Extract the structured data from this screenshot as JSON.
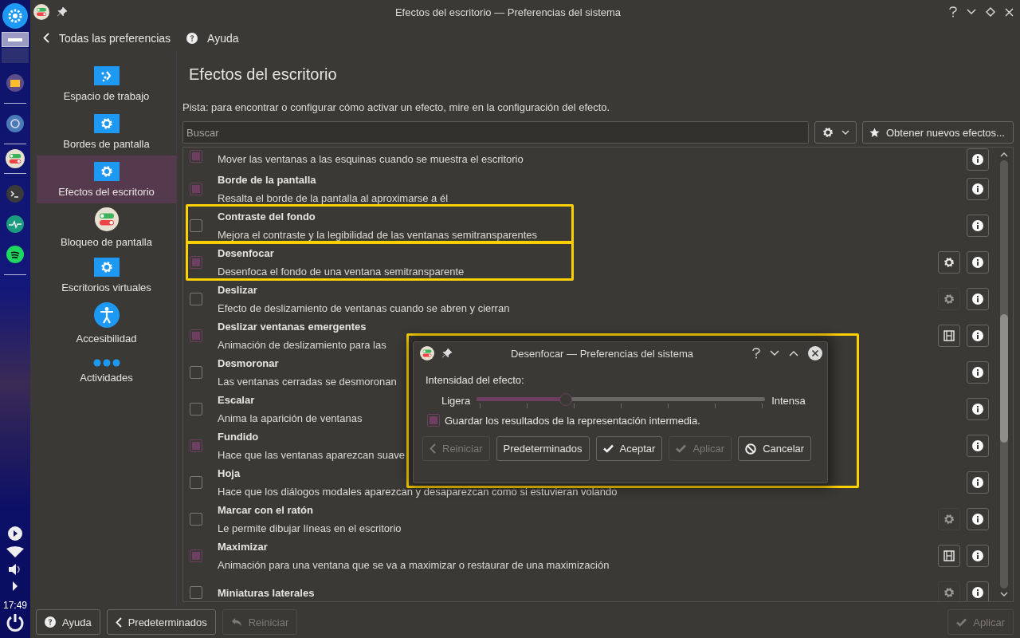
{
  "window": {
    "title": "Efectos del escritorio — Preferencias del sistema"
  },
  "taskbar": {
    "clock": "17:49"
  },
  "toolbar": {
    "back": "Todas las preferencias",
    "help": "Ayuda"
  },
  "sidebar": {
    "items": [
      {
        "label": "Espacio de trabajo",
        "kind": "workspace",
        "selected": false
      },
      {
        "label": "Bordes de pantalla",
        "kind": "gear",
        "selected": false
      },
      {
        "label": "Efectos del escritorio",
        "kind": "gear",
        "selected": true
      },
      {
        "label": "Bloqueo de pantalla",
        "kind": "toggle",
        "selected": false
      },
      {
        "label": "Escritorios virtuales",
        "kind": "gear",
        "selected": false
      },
      {
        "label": "Accesibilidad",
        "kind": "accessibility",
        "selected": false
      },
      {
        "label": "Actividades",
        "kind": "dots",
        "selected": false
      }
    ]
  },
  "page": {
    "title": "Efectos del escritorio",
    "hint": "Pista: para encontrar o configurar cómo activar un efecto, mire en la configuración del efecto.",
    "search": {
      "placeholder": "Buscar"
    },
    "get_new": "Obtener nuevos efectos..."
  },
  "effects": [
    {
      "description": "Mover las ventanas a las esquinas cuando se muestra el escritorio",
      "checked": true,
      "highlighted": false
    },
    {
      "title": "Borde de la pantalla",
      "description": "Resalta el borde de la pantalla al aproximarse a él",
      "checked": true,
      "highlighted": false
    },
    {
      "title": "Contraste del fondo",
      "description": "Mejora el contraste y la legibilidad de las ventanas semitransparentes",
      "checked": false,
      "highlighted": true
    },
    {
      "title": "Desenfocar",
      "description": "Desenfoca el fondo de una ventana semitransparente",
      "checked": true,
      "highlighted": true,
      "extra": {
        "kind": "configure",
        "disabled": false
      }
    },
    {
      "title": "Deslizar",
      "description": "Efecto de deslizamiento de ventanas cuando se abren y cierran",
      "checked": false,
      "highlighted": false,
      "extra": {
        "kind": "configure",
        "disabled": true
      }
    },
    {
      "title": "Deslizar ventanas emergentes",
      "description": "Animación de deslizamiento para las",
      "checked": true,
      "highlighted": false,
      "extra": {
        "kind": "video",
        "disabled": false
      }
    },
    {
      "title": "Desmoronar",
      "description": "Las ventanas cerradas se desmoronan",
      "checked": false,
      "highlighted": false
    },
    {
      "title": "Escalar",
      "description": "Anima la aparición de ventanas",
      "checked": false,
      "highlighted": false
    },
    {
      "title": "Fundido",
      "description": "Hace que las ventanas aparezcan suave",
      "checked": true,
      "highlighted": false
    },
    {
      "title": "Hoja",
      "description": "Hace que los diálogos modales aparezcan y desaparezcan como si estuvieran volando",
      "checked": false,
      "highlighted": false
    },
    {
      "title": "Marcar con el ratón",
      "description": "Le permite dibujar líneas en el escritorio",
      "checked": false,
      "highlighted": false,
      "extra": {
        "kind": "configure",
        "disabled": true
      }
    },
    {
      "title": "Maximizar",
      "description": "Animación para una ventana que se va a maximizar o restaurar de una maximización",
      "checked": true,
      "highlighted": false,
      "extra": {
        "kind": "video",
        "disabled": false
      }
    },
    {
      "title": "Miniaturas laterales",
      "checked": false,
      "highlighted": false,
      "extra": {
        "kind": "configure",
        "disabled": true
      }
    }
  ],
  "dialog": {
    "title": "Desenfocar — Preferencias del sistema",
    "highlighted": true,
    "label": "Intensidad del efecto:",
    "min_label": "Ligera",
    "max_label": "Intensa",
    "level": 0.31,
    "checkbox": {
      "label": "Guardar los resultados de la representación intermedia.",
      "checked": true
    },
    "buttons": [
      {
        "label": "Reiniciar",
        "kind": "back",
        "disabled": true
      },
      {
        "label": "Predeterminados",
        "kind": "plain",
        "disabled": false
      },
      {
        "label": "Aceptar",
        "kind": "ok",
        "disabled": false
      },
      {
        "label": "Aplicar",
        "kind": "ok",
        "disabled": true
      },
      {
        "label": "Cancelar",
        "kind": "cancel",
        "disabled": false
      }
    ]
  },
  "bottom_bar": {
    "buttons": [
      {
        "label": "Ayuda",
        "kind": "help",
        "disabled": false
      },
      {
        "label": "Predeterminados",
        "kind": "back",
        "disabled": false
      },
      {
        "label": "Reiniciar",
        "kind": "reset",
        "disabled": true
      },
      {
        "label": "Aplicar",
        "kind": "ok",
        "disabled": true
      }
    ]
  }
}
